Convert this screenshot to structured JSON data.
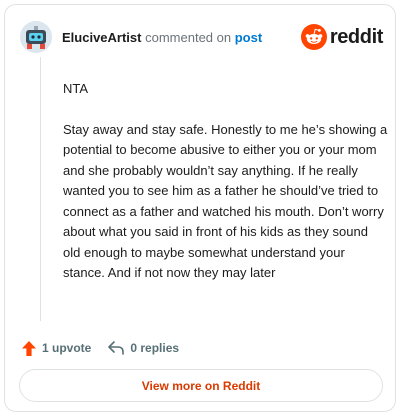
{
  "comment": {
    "username": "EluciveArtist",
    "commented_text": "commented on",
    "post_link": "post",
    "paragraphs": [
      "NTA",
      "Stay away and stay safe. Honestly to me he’s showing a potential to become abusive to either you or your mom and she probably wouldn’t say anything. If he really wanted you to see him as a father he should’ve tried to connect as a father and watched his mouth. Don’t worry about what you said in front of his kids as they sound old enough to maybe somewhat understand your stance. And if not now they may later"
    ]
  },
  "brand": {
    "wordmark": "reddit",
    "color": "#ff4500"
  },
  "actions": {
    "upvotes": "1 upvote",
    "replies": "0 replies"
  },
  "footer": {
    "view_more_label": "View more on Reddit"
  },
  "icons": [
    "avatar",
    "reddit-logo-icon",
    "upvote-arrow-icon",
    "reply-arrow-icon"
  ],
  "colors": {
    "accent": "#ff4500",
    "link": "#0079d3",
    "muted": "#576f76",
    "border": "#dfe2e4"
  }
}
